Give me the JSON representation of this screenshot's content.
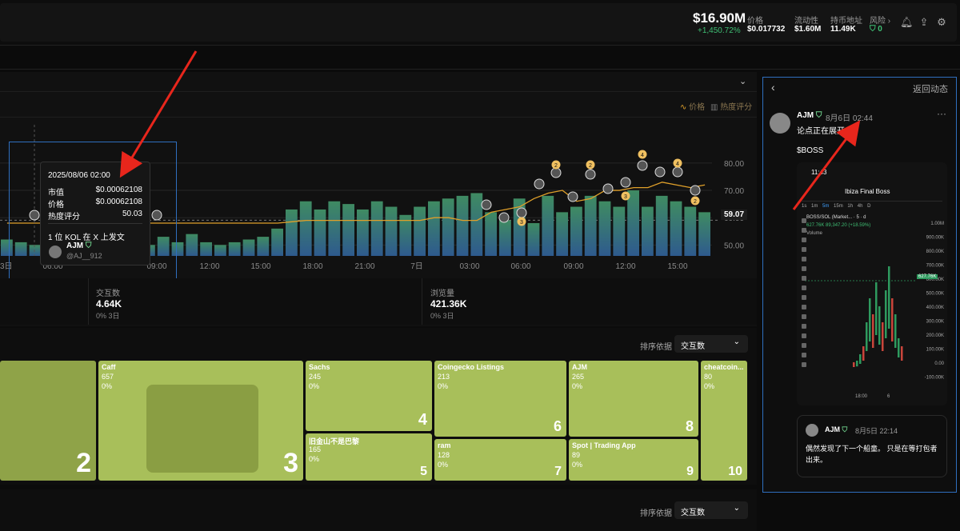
{
  "header": {
    "market_cap": "$16.90M",
    "market_cap_change": "+1,450.72%",
    "stats": [
      {
        "label": "价格",
        "value": "$0.017732"
      },
      {
        "label": "流动性",
        "value": "$1.60M"
      },
      {
        "label": "持币地址",
        "value": "11.49K"
      },
      {
        "label": "风险 ›",
        "value": "0"
      }
    ]
  },
  "chart": {
    "legend": {
      "price": "价格",
      "heat": "热度评分"
    },
    "current_value": "59.07"
  },
  "chart_data": {
    "type": "bar",
    "title": "",
    "x_ticks": [
      "3日",
      "06:00",
      "09:00",
      "12:00",
      "15:00",
      "18:00",
      "21:00",
      "7日",
      "03:00",
      "06:00",
      "09:00",
      "12:00",
      "15:00"
    ],
    "y_ticks": [
      "80.00",
      "70.00",
      "60.00",
      "50.00"
    ],
    "ylim": [
      46,
      87
    ],
    "heat_values": [
      52,
      51,
      50,
      52,
      53,
      51,
      51,
      50,
      52,
      52,
      50,
      53,
      51,
      54,
      51,
      50,
      51,
      52,
      53,
      56,
      63,
      66,
      63,
      66,
      65,
      63,
      66,
      64,
      61,
      64,
      66,
      67,
      68,
      69,
      62,
      59,
      67,
      58,
      68,
      62,
      64,
      68,
      66,
      64,
      70,
      64,
      68,
      66,
      64,
      62
    ],
    "price_line": [
      58,
      58,
      58,
      58,
      58,
      58,
      58,
      58,
      58,
      58,
      58,
      58,
      58,
      58,
      58,
      58,
      58,
      58,
      58,
      58,
      58.5,
      59,
      59,
      59,
      59,
      59,
      59,
      59,
      59,
      59,
      60,
      60,
      59,
      59,
      62,
      63,
      64,
      67,
      69,
      70,
      66,
      67,
      70,
      70,
      71,
      71,
      73,
      72,
      71,
      72
    ],
    "grid": true
  },
  "tooltip": {
    "date": "2025/08/06 02:00",
    "rows": [
      {
        "label": "市值",
        "value": "$0.00062108"
      },
      {
        "label": "价格",
        "value": "$0.00062108"
      },
      {
        "label": "热度评分",
        "value": "50.03"
      }
    ],
    "kol_text": "1 位 KOL 在 X 上发文",
    "kol_name": "AJM",
    "kol_handle": "@AJ__912"
  },
  "stat_cards": [
    {
      "label": "交互数",
      "value": "4.64K",
      "sub": "0% 3日"
    },
    {
      "label": "浏览量",
      "value": "421.36K",
      "sub": "0% 3日"
    }
  ],
  "sort": {
    "label": "排序依据",
    "value": "交互数"
  },
  "sort2": {
    "label": "排序依据",
    "value": "交互数"
  },
  "tiles": [
    {
      "name": "",
      "count": "",
      "pct": "",
      "rank": "2"
    },
    {
      "name": "Caff",
      "count": "657",
      "pct": "0%",
      "rank": "3"
    },
    {
      "name": "Sachs",
      "count": "245",
      "pct": "0%",
      "rank": "4"
    },
    {
      "name": "旧金山不是巴黎",
      "count": "165",
      "pct": "0%",
      "rank": "5"
    },
    {
      "name": "Coingecko Listings",
      "count": "213",
      "pct": "0%",
      "rank": "6"
    },
    {
      "name": "ram",
      "count": "128",
      "pct": "0%",
      "rank": "7"
    },
    {
      "name": "AJM",
      "count": "265",
      "pct": "0%",
      "rank": "8"
    },
    {
      "name": "Spot | Trading App",
      "count": "89",
      "pct": "0%",
      "rank": "9"
    },
    {
      "name": "cheatcoin...",
      "count": "80",
      "pct": "0%",
      "rank": "10"
    }
  ],
  "right_panel": {
    "back_label": "返回动态",
    "author": "AJM",
    "time": "8月6日 02:44",
    "text1": "论点正在展开。",
    "text2": "$BOSS",
    "embed": {
      "status_time": "11:43",
      "title": "Ibiza Final Boss",
      "pair": "BOSS/SOL (Market... · 5 · d",
      "pair_change": "627.76K 89,347.20 (+18.59%)",
      "volume": "Volume",
      "price_tag": "627.76K",
      "axis": [
        "1.00M",
        "900.00K",
        "800.00K",
        "700.00K",
        "600.00K",
        "500.00K",
        "400.00K",
        "300.00K",
        "200.00K",
        "100.00K",
        "0.00",
        "-100.00K"
      ],
      "timeframes": [
        "1s",
        "1m",
        "5m",
        "15m",
        "1h",
        "4h",
        "D"
      ],
      "xlabels": [
        "18:00",
        "6"
      ]
    },
    "quote": {
      "author": "AJM",
      "time": "8月5日 22:14",
      "text": "偶然发现了下一个船童。 只是在等打包者出来。"
    }
  }
}
